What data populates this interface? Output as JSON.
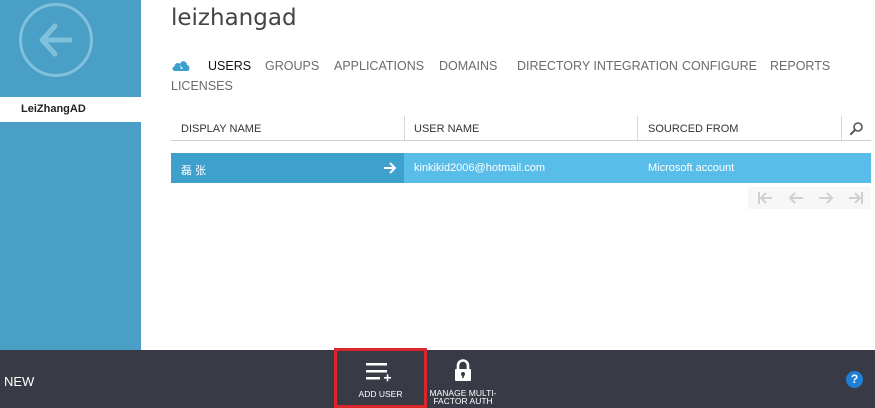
{
  "sidebar": {
    "items": [
      {
        "label": "LeiZhangAD"
      }
    ]
  },
  "page": {
    "title": "leizhangad"
  },
  "nav": {
    "tabs": [
      {
        "label": "USERS",
        "active": true
      },
      {
        "label": "GROUPS"
      },
      {
        "label": "APPLICATIONS"
      },
      {
        "label": "DOMAINS"
      },
      {
        "label": "DIRECTORY INTEGRATION"
      },
      {
        "label": "CONFIGURE"
      },
      {
        "label": "REPORTS"
      },
      {
        "label": "LICENSES"
      }
    ]
  },
  "table": {
    "columns": [
      "DISPLAY NAME",
      "USER NAME",
      "SOURCED FROM"
    ],
    "rows": [
      {
        "display_name": "磊 张",
        "user_name": "kinkikid2006@hotmail.com",
        "sourced_from": "Microsoft account"
      }
    ]
  },
  "commandbar": {
    "new_label": "NEW",
    "add_user_label": "ADD USER",
    "mfa_label_line1": "MANAGE MULTI-",
    "mfa_label_line2": "FACTOR AUTH",
    "help_label": "?"
  },
  "colors": {
    "sidebar": "#4a9fc6",
    "row_selected_primary": "#3ea0cd",
    "row_selected_secondary": "#59bde9",
    "commandbar": "#383b45",
    "highlight": "#d9262a",
    "help": "#1f7fd6"
  },
  "icons": {
    "back": "arrow-left-circle-icon",
    "cloud": "cloud-icon",
    "search": "search-icon",
    "row_arrow": "arrow-right-icon",
    "add_user": "add-list-icon",
    "mfa": "lock-icon",
    "help": "question-icon"
  }
}
